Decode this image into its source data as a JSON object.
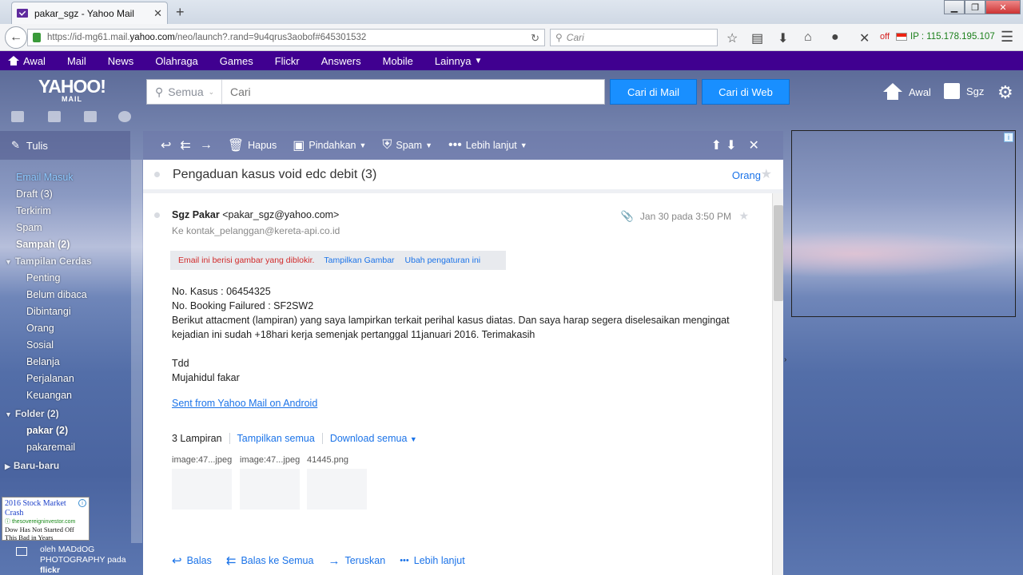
{
  "browser": {
    "tab_title": "pakar_sgz - Yahoo Mail",
    "tab_close": "✕",
    "new_tab": "+",
    "url_prefix": "https://id-mg61.mail.",
    "url_domain": "yahoo.com",
    "url_suffix": "/neo/launch?.rand=9u4qrus3aobof#645301532",
    "search_placeholder": "Cari",
    "vpn_status": "off",
    "ip_label": "IP : 115.178.195.107"
  },
  "yahoo_nav": {
    "items": [
      "Awal",
      "Mail",
      "News",
      "Olahraga",
      "Games",
      "Flickr",
      "Answers",
      "Mobile",
      "Lainnya"
    ]
  },
  "header": {
    "logo_text": "YAHOO!",
    "logo_sub": "MAIL",
    "search_scope": "Semua",
    "search_placeholder": "Cari",
    "btn_search_mail": "Cari di Mail",
    "btn_search_web": "Cari di Web",
    "home_label": "Awal",
    "user_label": "Sgz"
  },
  "sidebar": {
    "compose": "Tulis",
    "folders": [
      {
        "label": "Email Masuk",
        "selected": true
      },
      {
        "label": "Draft (3)"
      },
      {
        "label": "Terkirim"
      },
      {
        "label": "Spam"
      },
      {
        "label": "Sampah  (2)",
        "bold": true
      }
    ],
    "smart_header": "Tampilan Cerdas",
    "smart_items": [
      "Penting",
      "Belum dibaca",
      "Dibintangi",
      "Orang",
      "Sosial",
      "Belanja",
      "Perjalanan",
      "Keuangan"
    ],
    "folder_header": "Folder (2)",
    "custom_folders": [
      {
        "label": "pakar  (2)",
        "bold": true
      },
      {
        "label": "pakaremail"
      }
    ],
    "recent_header": "Baru-baru",
    "ad": {
      "title": "2016 Stock Market Crash",
      "source": "thesovereigninvestor.com",
      "desc": "Dow Has Not Started Off This Bad in Years"
    },
    "photo_credit_1": "oleh MADdOG",
    "photo_credit_2": "PHOTOGRAPHY pada",
    "photo_credit_3": "flickr"
  },
  "toolbar": {
    "delete": "Hapus",
    "move": "Pindahkan",
    "spam": "Spam",
    "more": "Lebih lanjut"
  },
  "message": {
    "subject": "Pengaduan kasus void edc debit (3)",
    "people_link": "Orang",
    "from_name": "Sgz Pakar",
    "from_email": "<pakar_sgz@yahoo.com>",
    "to_label": "Ke",
    "to_email": "kontak_pelanggan@kereta-api.co.id",
    "date": "Jan 30 pada 3:50 PM",
    "blocked_warning": "Email ini berisi gambar yang diblokir.",
    "show_images": "Tampilkan Gambar",
    "change_settings": "Ubah pengaturan ini",
    "body_lines": [
      "No. Kasus : 06454325",
      "No. Booking Failured : SF2SW2",
      "Berikut attacment (lampiran) yang saya lampirkan terkait perihal kasus diatas. Dan saya harap segera diselesaikan mengingat kejadian ini sudah +18hari kerja semenjak pertanggal 11januari 2016. Terimakasih",
      "",
      "Tdd",
      "Mujahidul fakar"
    ],
    "signature_link": "Sent from Yahoo Mail on Android",
    "attachments_count": "3 Lampiran",
    "show_all": "Tampilkan semua",
    "download_all": "Download semua",
    "attachments": [
      "image:47...jpeg",
      "image:47...jpeg",
      "41445.png"
    ],
    "actions": {
      "reply": "Balas",
      "reply_all": "Balas ke Semua",
      "forward": "Teruskan",
      "more": "Lebih lanjut"
    }
  },
  "colors": {
    "yahoo_purple": "#400090",
    "link_blue": "#1b73e8",
    "button_blue": "#198fff",
    "warning_red": "#d12a2a"
  }
}
